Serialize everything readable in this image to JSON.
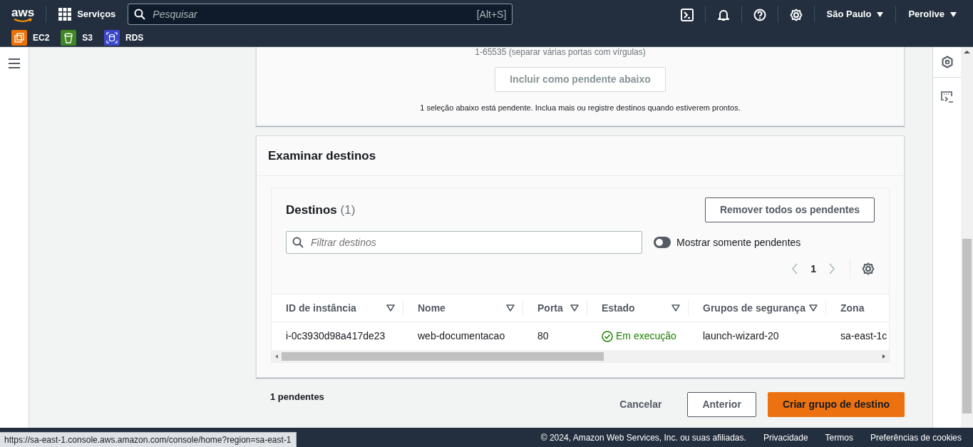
{
  "header": {
    "logo": "aws",
    "services_label": "Serviços",
    "search": {
      "placeholder": "Pesquisar",
      "shortcut": "[Alt+S]"
    },
    "region": "São Paulo",
    "account": "Perolive"
  },
  "favorites": [
    {
      "label": "EC2",
      "kind": "compute",
      "color": "#ed7100"
    },
    {
      "label": "S3",
      "kind": "storage",
      "color": "#3f8624"
    },
    {
      "label": "RDS",
      "kind": "database",
      "color": "#3b48cc"
    }
  ],
  "port_panel": {
    "hint": "1-65535 (separar várias portas com vírgulas)",
    "include_button": {
      "label": "Incluir como pendente abaixo",
      "disabled": true
    },
    "pending_note": "1 seleção abaixo está pendente. Inclua mais ou registre destinos quando estiverem prontos."
  },
  "review": {
    "title": "Examinar destinos",
    "targets": {
      "title": "Destinos",
      "count": "(1)",
      "remove_button": "Remover todos os pendentes",
      "filter_placeholder": "Filtrar destinos",
      "toggle": {
        "label": "Mostrar somente pendentes",
        "on": false
      },
      "pages": [
        {
          "label": "1",
          "selected": true
        }
      ],
      "prev_disabled": true,
      "next_disabled": true,
      "columns": [
        {
          "label": "ID de instância"
        },
        {
          "label": "Nome"
        },
        {
          "label": "Porta"
        },
        {
          "label": "Estado"
        },
        {
          "label": "Grupos de segurança"
        },
        {
          "label": "Zona"
        }
      ],
      "rows": [
        {
          "instance_id": "i-0c3930d98a417de23",
          "name": "web-documentacao",
          "port": "80",
          "state": {
            "label": "Em execução",
            "kind": "running"
          },
          "security_groups": "launch-wizard-20",
          "zone": "sa-east-1c"
        }
      ]
    }
  },
  "actions": {
    "pending": "1 pendentes",
    "cancel": "Cancelar",
    "previous": "Anterior",
    "create": "Criar grupo de destino"
  },
  "footer": {
    "copyright": "© 2024, Amazon Web Services, Inc. ou suas afiliadas.",
    "links": [
      "Privacidade",
      "Termos",
      "Preferências de cookies"
    ]
  },
  "status_url": "https://sa-east-1.console.aws.amazon.com/console/home?region=sa-east-1"
}
